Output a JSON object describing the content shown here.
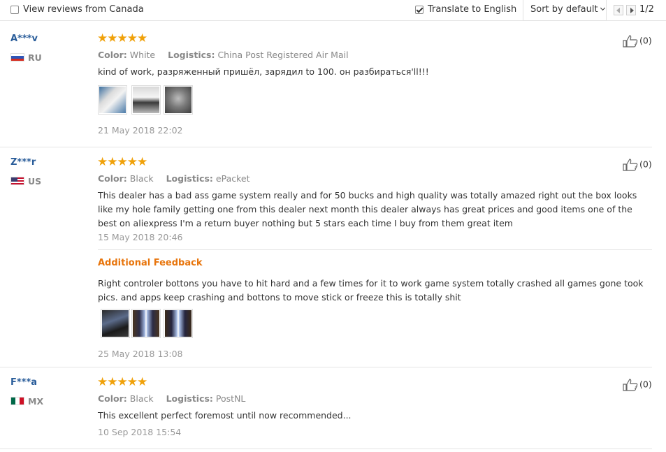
{
  "topbar": {
    "view_canada_label": "View reviews from Canada",
    "view_canada_checked": false,
    "translate_label": "Translate to English",
    "translate_checked": true,
    "sort_label": "Sort by default",
    "page_indicator": "1/2"
  },
  "icons": {
    "star": "star-icon",
    "thumb": "thumbs-up-icon",
    "prev": "prev-page-icon",
    "next": "next-page-icon"
  },
  "colors": {
    "star": "#f0a10a",
    "username": "#2a5d9a",
    "additional_feedback": "#e8750c"
  },
  "reviews": [
    {
      "user": "A***v",
      "country": "RU",
      "stars": "★★★★★",
      "rating": 5,
      "color_label": "Color:",
      "color_value": "White",
      "logistics_label": "Logistics:",
      "logistics_value": "China Post Registered Air Mail",
      "text": "kind of work, разряженный пришёл, зарядил to 100. он разбираться'll!!!",
      "date": "21 May 2018 22:02",
      "helpful": "(0)"
    },
    {
      "user": "Z***r",
      "country": "US",
      "stars": "★★★★★",
      "rating": 5,
      "color_label": "Color:",
      "color_value": "Black",
      "logistics_label": "Logistics:",
      "logistics_value": "ePacket",
      "text": "This dealer has a bad ass game system really and for 50 bucks and high quality was totally amazed right out the box looks like my hole family getting one from this dealer next month this dealer always has great prices and good items one of the best on aliexpress I'm a return buyer nothing but 5 stars each time I buy from them great item",
      "date": "15 May 2018 20:46",
      "helpful": "(0)",
      "additional_title": "Additional Feedback",
      "additional_text": "Right controler bottons you have to hit hard and a few times for it to work game system totally crashed all games gone took pics. and apps keep crashing and bottons to move stick or freeze this is totally shit",
      "additional_date": "25 May 2018 13:08"
    },
    {
      "user": "F***a",
      "country": "MX",
      "stars": "★★★★★",
      "rating": 5,
      "color_label": "Color:",
      "color_value": "Black",
      "logistics_label": "Logistics:",
      "logistics_value": "PostNL",
      "text": "This excellent perfect foremost until now recommended...",
      "date": "10 Sep 2018 15:54",
      "helpful": "(0)"
    }
  ]
}
